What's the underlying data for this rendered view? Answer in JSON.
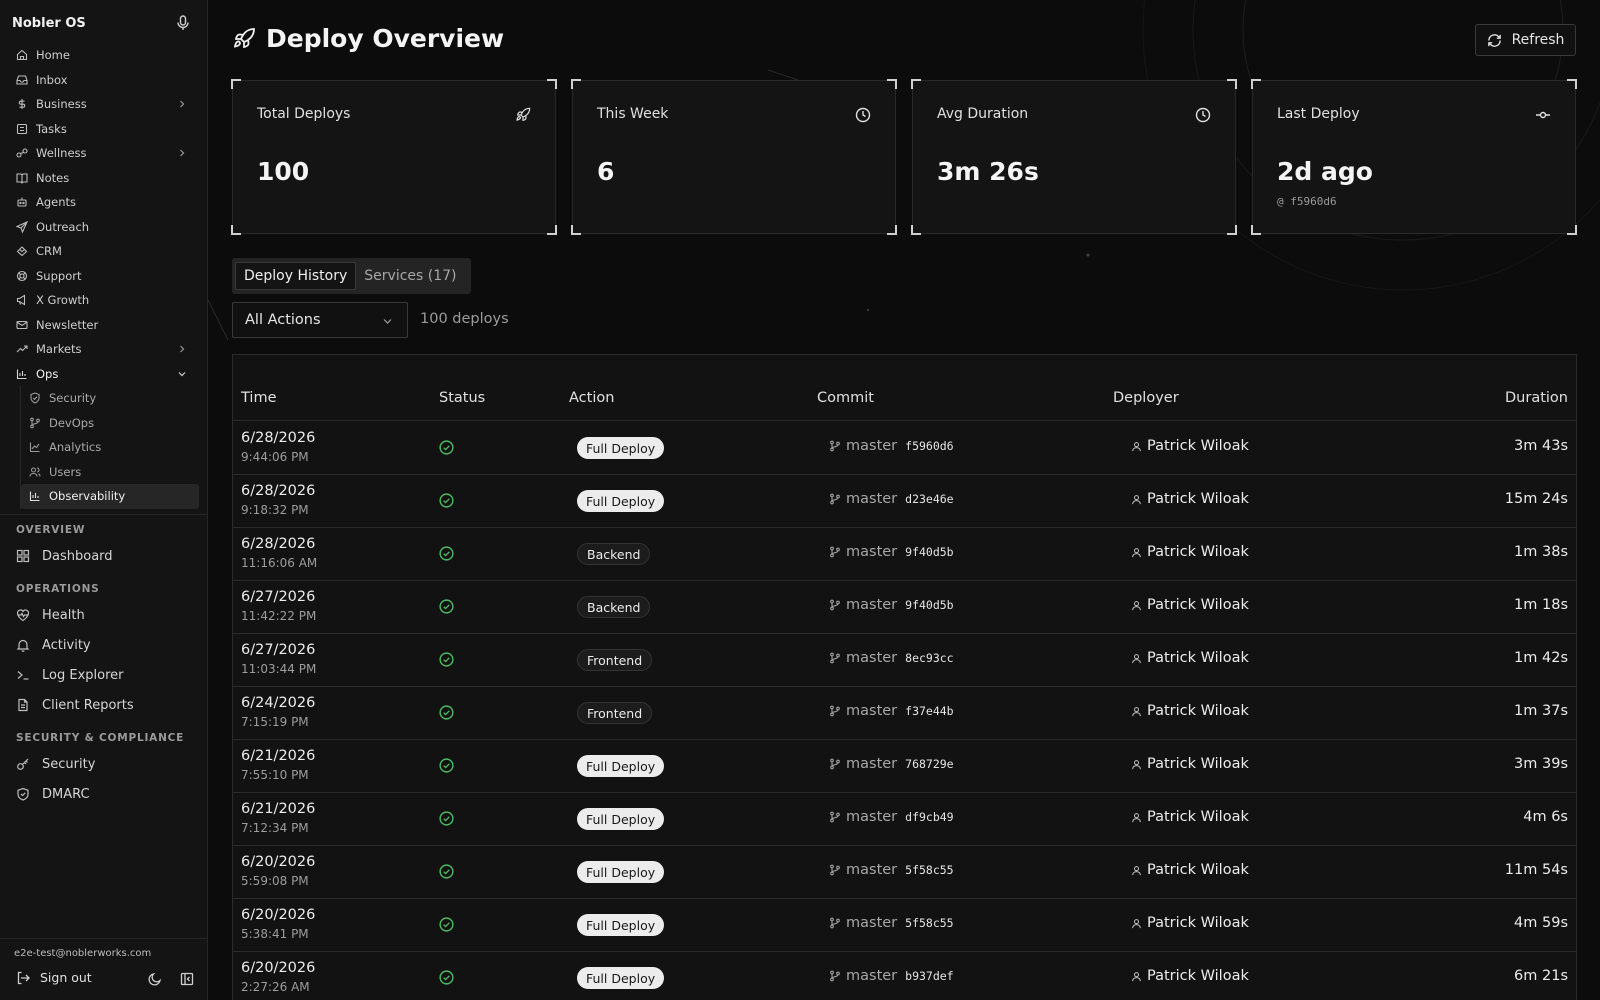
{
  "app": {
    "name": "Nobler OS"
  },
  "sidebar": {
    "nav": [
      {
        "label": "Home",
        "icon": "home-icon"
      },
      {
        "label": "Inbox",
        "icon": "inbox-icon"
      },
      {
        "label": "Business",
        "icon": "dollar-icon",
        "expandable": true
      },
      {
        "label": "Tasks",
        "icon": "tasks-icon"
      },
      {
        "label": "Wellness",
        "icon": "wellness-icon",
        "expandable": true
      },
      {
        "label": "Notes",
        "icon": "book-icon"
      },
      {
        "label": "Agents",
        "icon": "bot-icon"
      },
      {
        "label": "Outreach",
        "icon": "send-icon"
      },
      {
        "label": "CRM",
        "icon": "crm-icon"
      },
      {
        "label": "Support",
        "icon": "lifebuoy-icon"
      },
      {
        "label": "X Growth",
        "icon": "megaphone-icon"
      },
      {
        "label": "Newsletter",
        "icon": "mail-icon"
      },
      {
        "label": "Markets",
        "icon": "trending-up-icon",
        "expandable": true
      },
      {
        "label": "Ops",
        "icon": "bar-chart-icon",
        "expanded": true
      }
    ],
    "ops_sub": [
      {
        "label": "Security",
        "icon": "shield-check-icon"
      },
      {
        "label": "DevOps",
        "icon": "git-branch-icon"
      },
      {
        "label": "Analytics",
        "icon": "line-chart-icon"
      },
      {
        "label": "Users",
        "icon": "users-icon"
      },
      {
        "label": "Observability",
        "icon": "bar-chart-icon",
        "active": true
      }
    ],
    "sections": [
      {
        "title": "OVERVIEW",
        "items": [
          {
            "label": "Dashboard",
            "icon": "grid-icon"
          }
        ]
      },
      {
        "title": "OPERATIONS",
        "items": [
          {
            "label": "Health",
            "icon": "heart-pulse-icon"
          },
          {
            "label": "Activity",
            "icon": "bell-icon"
          },
          {
            "label": "Log Explorer",
            "icon": "terminal-icon"
          },
          {
            "label": "Client Reports",
            "icon": "file-icon"
          }
        ]
      },
      {
        "title": "SECURITY & COMPLIANCE",
        "items": [
          {
            "label": "Security",
            "icon": "key-icon"
          },
          {
            "label": "DMARC",
            "icon": "shield-icon"
          }
        ]
      }
    ],
    "user_email": "e2e-test@noblerworks.com",
    "signout_label": "Sign out"
  },
  "page": {
    "title": "Deploy Overview",
    "refresh_label": "Refresh"
  },
  "stats": [
    {
      "label": "Total Deploys",
      "value": "100",
      "icon": "rocket-icon"
    },
    {
      "label": "This Week",
      "value": "6",
      "icon": "clock-icon"
    },
    {
      "label": "Avg Duration",
      "value": "3m 26s",
      "icon": "clock-icon"
    },
    {
      "label": "Last Deploy",
      "value": "2d ago",
      "sub": "@ f5960d6",
      "icon": "commit-icon"
    }
  ],
  "tabs": [
    {
      "label": "Deploy History",
      "active": true
    },
    {
      "label": "Services (17)",
      "active": false
    }
  ],
  "filter": {
    "selected": "All Actions",
    "count_text": "100 deploys"
  },
  "table": {
    "columns": [
      "Time",
      "Status",
      "Action",
      "Commit",
      "Deployer",
      "Duration"
    ],
    "rows": [
      {
        "date": "6/28/2026",
        "time": "9:44:06 PM",
        "status": "success",
        "action": "Full Deploy",
        "branch": "master",
        "sha": "f5960d6",
        "deployer": "Patrick Wiloak",
        "duration": "3m 43s"
      },
      {
        "date": "6/28/2026",
        "time": "9:18:32 PM",
        "status": "success",
        "action": "Full Deploy",
        "branch": "master",
        "sha": "d23e46e",
        "deployer": "Patrick Wiloak",
        "duration": "15m 24s"
      },
      {
        "date": "6/28/2026",
        "time": "11:16:06 AM",
        "status": "success",
        "action": "Backend",
        "branch": "master",
        "sha": "9f40d5b",
        "deployer": "Patrick Wiloak",
        "duration": "1m 38s"
      },
      {
        "date": "6/27/2026",
        "time": "11:42:22 PM",
        "status": "success",
        "action": "Backend",
        "branch": "master",
        "sha": "9f40d5b",
        "deployer": "Patrick Wiloak",
        "duration": "1m 18s"
      },
      {
        "date": "6/27/2026",
        "time": "11:03:44 PM",
        "status": "success",
        "action": "Frontend",
        "branch": "master",
        "sha": "8ec93cc",
        "deployer": "Patrick Wiloak",
        "duration": "1m 42s"
      },
      {
        "date": "6/24/2026",
        "time": "7:15:19 PM",
        "status": "success",
        "action": "Frontend",
        "branch": "master",
        "sha": "f37e44b",
        "deployer": "Patrick Wiloak",
        "duration": "1m 37s"
      },
      {
        "date": "6/21/2026",
        "time": "7:55:10 PM",
        "status": "success",
        "action": "Full Deploy",
        "branch": "master",
        "sha": "768729e",
        "deployer": "Patrick Wiloak",
        "duration": "3m 39s"
      },
      {
        "date": "6/21/2026",
        "time": "7:12:34 PM",
        "status": "success",
        "action": "Full Deploy",
        "branch": "master",
        "sha": "df9cb49",
        "deployer": "Patrick Wiloak",
        "duration": "4m 6s"
      },
      {
        "date": "6/20/2026",
        "time": "5:59:08 PM",
        "status": "success",
        "action": "Full Deploy",
        "branch": "master",
        "sha": "5f58c55",
        "deployer": "Patrick Wiloak",
        "duration": "11m 54s"
      },
      {
        "date": "6/20/2026",
        "time": "5:38:41 PM",
        "status": "success",
        "action": "Full Deploy",
        "branch": "master",
        "sha": "5f58c55",
        "deployer": "Patrick Wiloak",
        "duration": "4m 59s"
      },
      {
        "date": "6/20/2026",
        "time": "2:27:26 AM",
        "status": "success",
        "action": "Full Deploy",
        "branch": "master",
        "sha": "b937def",
        "deployer": "Patrick Wiloak",
        "duration": "6m 21s"
      }
    ]
  },
  "colors": {
    "success": "#4cbb63",
    "background": "#0c0c0c",
    "panel": "#141414",
    "border": "#2a2a2a"
  }
}
